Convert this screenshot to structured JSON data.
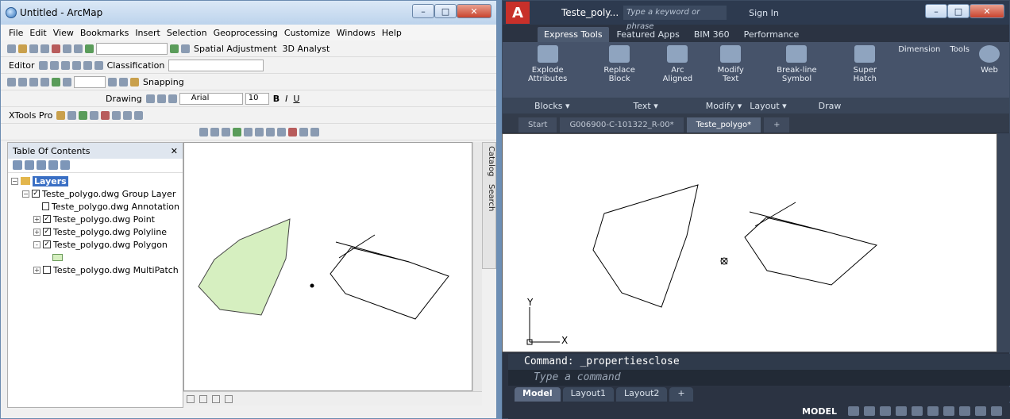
{
  "arcmap": {
    "title": "Untitled - ArcMap",
    "menu": [
      "File",
      "Edit",
      "View",
      "Bookmarks",
      "Insert",
      "Selection",
      "Geoprocessing",
      "Customize",
      "Windows",
      "Help"
    ],
    "toolbars": {
      "spatial_adjustment": "Spatial Adjustment",
      "analyst_3d": "3D Analyst",
      "editor": "Editor",
      "classification": "Classification",
      "snapping": "Snapping",
      "drawing": "Drawing",
      "font": "Arial",
      "font_size": "10",
      "xtools": "XTools Pro"
    },
    "toc": {
      "title": "Table Of Contents",
      "layers_root": "Layers",
      "group_layer": "Teste_polygo.dwg Group Layer",
      "items": [
        {
          "label": "Teste_polygo.dwg Annotation",
          "checked": false,
          "expand": ""
        },
        {
          "label": "Teste_polygo.dwg Point",
          "checked": true,
          "expand": "+"
        },
        {
          "label": "Teste_polygo.dwg Polyline",
          "checked": true,
          "expand": "+"
        },
        {
          "label": "Teste_polygo.dwg Polygon",
          "checked": true,
          "expand": "-"
        },
        {
          "label": "Teste_polygo.dwg MultiPatch",
          "checked": false,
          "expand": "+"
        }
      ]
    },
    "side_tabs": [
      "Catalog",
      "Search"
    ],
    "colors": {
      "polygon_fill": "#d6efc0"
    }
  },
  "autocad": {
    "title": "Teste_poly...",
    "search_placeholder": "Type a keyword or phrase",
    "sign_in": "Sign In",
    "ribbon_tabs": [
      "Express Tools",
      "Featured Apps",
      "BIM 360",
      "Performance"
    ],
    "ribbon_groups": [
      {
        "label": "Explode Attributes"
      },
      {
        "label": "Replace Block"
      },
      {
        "label": "Arc Aligned"
      },
      {
        "label": "Modify Text"
      },
      {
        "label": "Break-line Symbol"
      },
      {
        "label": "Super Hatch"
      },
      {
        "label": "Dimension"
      },
      {
        "label": "Tools"
      },
      {
        "label": "Web"
      }
    ],
    "ribbon_panels": [
      "Blocks ▾",
      "Text ▾",
      "Modify ▾",
      "Layout ▾",
      "Draw"
    ],
    "doc_tabs": [
      "Start",
      "G006900-C-101322_R-00*",
      "Teste_polygo*"
    ],
    "command_history": "Command: _propertiesclose",
    "command_placeholder": "Type a command",
    "layout_tabs": [
      "Model",
      "Layout1",
      "Layout2"
    ],
    "status_model": "MODEL",
    "axis_y": "Y",
    "axis_x": "X"
  }
}
